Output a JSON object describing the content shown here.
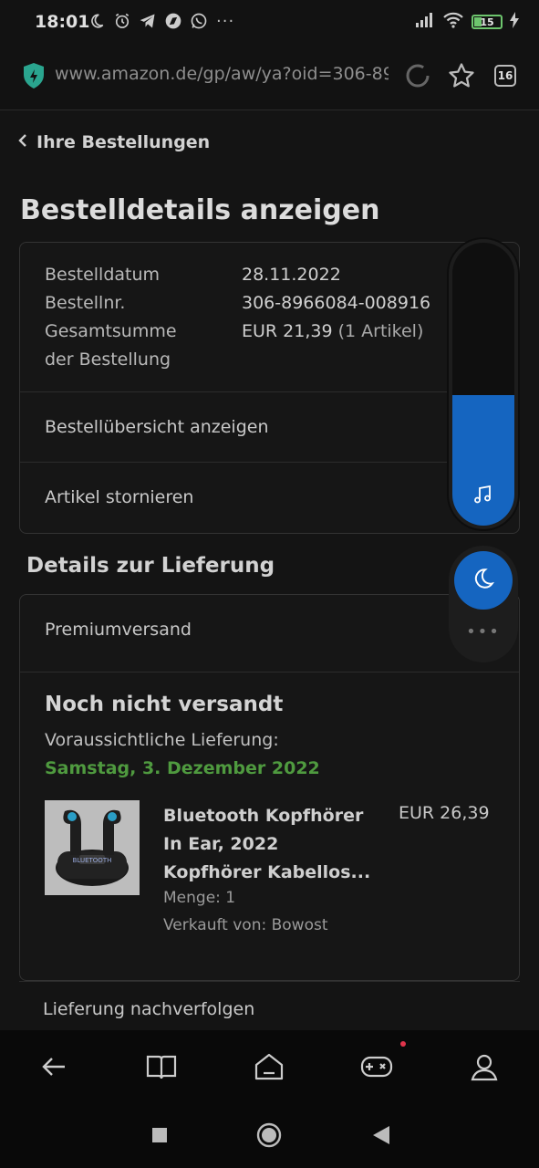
{
  "status_bar": {
    "time": "18:01",
    "more": "···",
    "battery": "15",
    "icons": [
      "moon-icon",
      "alarm-icon",
      "telegram-icon",
      "compass-icon",
      "whatsapp-icon",
      "signal-icon",
      "wifi-icon",
      "charging-icon"
    ]
  },
  "browser": {
    "url": "www.amazon.de/gp/aw/ya?oid=306-89",
    "tab_count": "16"
  },
  "page": {
    "back_label": "Ihre Bestellungen",
    "title": "Bestelldetails anzeigen"
  },
  "order": {
    "date_label": "Bestelldatum",
    "date_value": "28.11.2022",
    "number_label": "Bestellnr.",
    "number_value": "306-8966084-008916",
    "total_label_1": "Gesamtsumme",
    "total_label_2": "der Bestellung",
    "total_value": "EUR 21,39",
    "total_items": "(1 Artikel)",
    "summary_link": "Bestellübersicht anzeigen",
    "cancel_link": "Artikel stornieren"
  },
  "delivery": {
    "section_title": "Details zur Lieferung",
    "shipping_method": "Premiumversand",
    "status": "Noch nicht versandt",
    "eta_label": "Voraussichtliche Lieferung:",
    "eta_date": "Samstag, 3. Dezember 2022",
    "track_link": "Lieferung nachverfolgen"
  },
  "product": {
    "title_line1": "Bluetooth Kopfhörer",
    "title_line2": "In Ear, 2022",
    "title_line3": "Kopfhörer Kabellos...",
    "price": "EUR 26,39",
    "quantity": "Menge: 1",
    "seller": "Verkauft von: Bowost",
    "image_text": "BLUETOOTH"
  },
  "volume_overlay": {
    "level_fraction": 0.46,
    "accent": "#1565c0"
  },
  "colors": {
    "accent_green": "#4f9a3f",
    "accent_blue": "#1565c0",
    "battery_green": "#6dc56d"
  }
}
